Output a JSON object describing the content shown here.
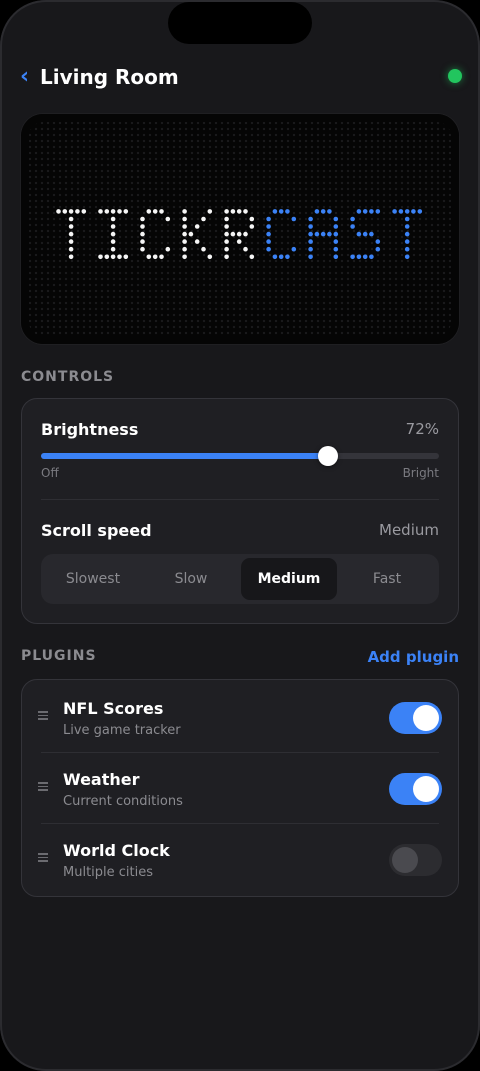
{
  "header": {
    "back_icon": "chevron-left-icon",
    "title": "Living Room",
    "status_color": "#22c55e"
  },
  "display": {
    "text_left": "TICKR",
    "text_right": "CAST",
    "color_left": "#f5f5f5",
    "color_right": "#3b82f6"
  },
  "controls": {
    "section_label": "CONTROLS",
    "brightness": {
      "label": "Brightness",
      "value_text": "72%",
      "value": 0.72,
      "min_label": "Off",
      "max_label": "Bright"
    },
    "scroll_speed": {
      "label": "Scroll speed",
      "value_text": "Medium",
      "options": [
        "Slowest",
        "Slow",
        "Medium",
        "Fast"
      ],
      "selected": "Medium"
    }
  },
  "plugins": {
    "section_label": "PLUGINS",
    "add_label": "Add plugin",
    "items": [
      {
        "name": "NFL Scores",
        "description": "Live game tracker",
        "enabled": true
      },
      {
        "name": "Weather",
        "description": "Current conditions",
        "enabled": true
      },
      {
        "name": "World Clock",
        "description": "Multiple cities",
        "enabled": false
      }
    ]
  },
  "colors": {
    "accent": "#3b82f6",
    "background": "#18181b",
    "card": "#1f1f23"
  }
}
